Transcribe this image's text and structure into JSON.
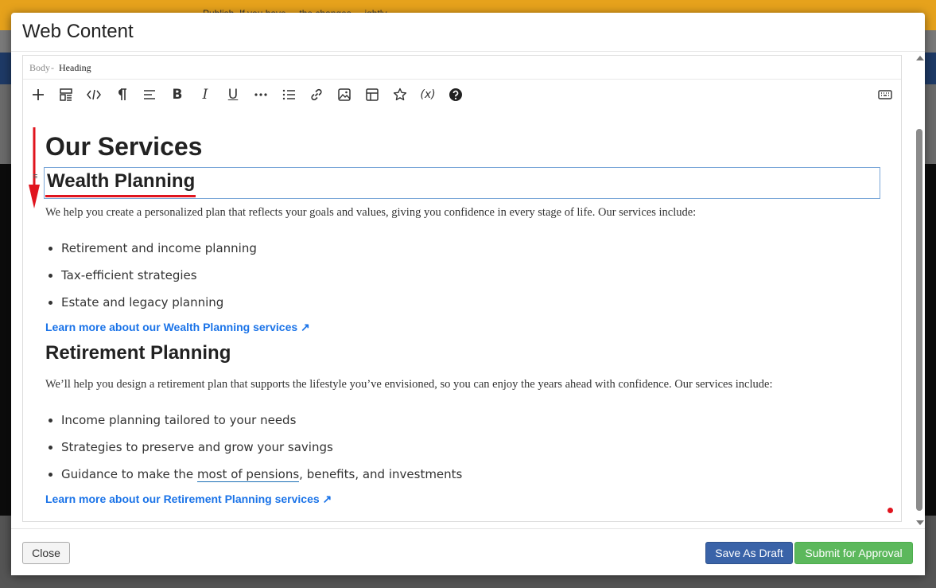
{
  "background": {
    "banner_text": "Publish. If you have ... the changes ... ightly"
  },
  "modal": {
    "title": "Web Content",
    "breadcrumb": {
      "body": "Body",
      "separator": "-",
      "current": "Heading"
    },
    "toolbar": {
      "buttons": [
        {
          "name": "add-icon"
        },
        {
          "name": "fragments-icon"
        },
        {
          "name": "source-code-icon"
        },
        {
          "name": "paragraph-icon"
        },
        {
          "name": "align-icon"
        },
        {
          "name": "bold-icon",
          "label": "B"
        },
        {
          "name": "italic-icon",
          "label": "I"
        },
        {
          "name": "underline-icon",
          "label": "U"
        },
        {
          "name": "more-icon"
        },
        {
          "name": "bulleted-list-icon"
        },
        {
          "name": "link-icon"
        },
        {
          "name": "image-icon"
        },
        {
          "name": "table-icon"
        },
        {
          "name": "star-icon"
        },
        {
          "name": "variable-icon",
          "label": "(x)"
        },
        {
          "name": "help-icon"
        },
        {
          "name": "keyboard-icon"
        }
      ]
    },
    "content": {
      "h1": "Our Services",
      "sections": [
        {
          "heading": "Wealth Planning",
          "intro": "We help you create a personalized plan that reflects your goals and values, giving you confidence in every stage of life. Our services include:",
          "items": [
            "Retirement and income planning",
            "Tax-efficient strategies",
            "Estate and legacy planning"
          ],
          "link": "Learn more about our Wealth Planning services ↗"
        },
        {
          "heading": "Retirement Planning",
          "intro": "We’ll help you design a retirement plan that supports the lifestyle you’ve envisioned, so you can enjoy the years ahead with confidence. Our services include:",
          "items": [
            "Income planning tailored to your needs",
            "Strategies to preserve and grow your savings"
          ],
          "last_item": {
            "before": "Guidance to make the ",
            "underlined": "most of pensions",
            "after": ", benefits, and investments"
          },
          "link": "Learn more about our Retirement Planning services ↗"
        }
      ]
    },
    "footer": {
      "close_label": "Close",
      "draft_label": "Save As Draft",
      "submit_label": "Submit for Approval"
    }
  },
  "colors": {
    "annotation_red": "#e0141e",
    "link_blue": "#1a73e8",
    "draft_blue": "#3a63a8",
    "submit_green": "#5cb85c"
  }
}
